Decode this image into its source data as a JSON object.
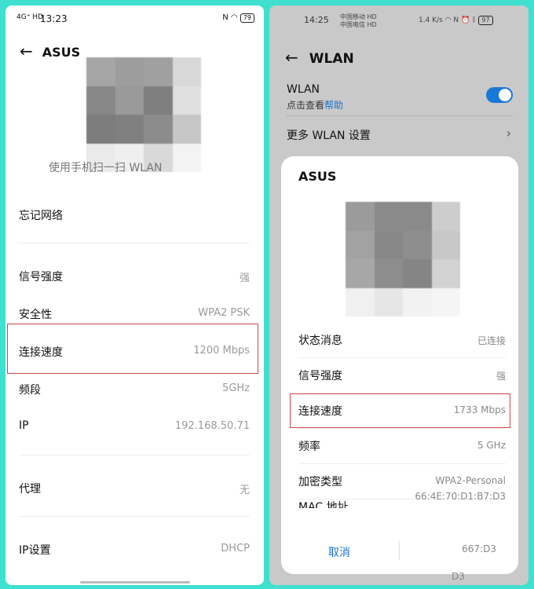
{
  "left": {
    "status": {
      "time": "13:23",
      "left_icons": "4G⁺ HD",
      "battery": "79"
    },
    "header": {
      "title": "ASUS"
    },
    "scan_text": "使用手机扫一扫  WLAN",
    "rows": [
      {
        "label": "忘记网络",
        "value": ""
      },
      {
        "label": "信号强度",
        "value": "强"
      },
      {
        "label": "安全性",
        "value": "WPA2 PSK"
      },
      {
        "label": "连接速度",
        "value": "1200 Mbps"
      },
      {
        "label": "频段",
        "value": "5GHz"
      },
      {
        "label": "IP",
        "value": "192.168.50.71"
      },
      {
        "label": "代理",
        "value": "无"
      },
      {
        "label": "IP设置",
        "value": "DHCP"
      }
    ]
  },
  "right": {
    "status": {
      "time": "14:25",
      "carrier1": "中国移动 HD",
      "carrier2": "中国电信 HD",
      "net_speed": "1.4 K/s",
      "battery": "97"
    },
    "header": {
      "title": "WLAN"
    },
    "wlan": {
      "label": "WLAN",
      "hint": "点击查看",
      "help": "帮助",
      "enabled": true
    },
    "more_settings": "更多 WLAN 设置",
    "dialog": {
      "title": "ASUS",
      "rows": [
        {
          "label": "状态消息",
          "value": "已连接"
        },
        {
          "label": "信号强度",
          "value": "强"
        },
        {
          "label": "连接速度",
          "value": "1733 Mbps"
        },
        {
          "label": "频率",
          "value": "5 GHz"
        },
        {
          "label": "加密类型",
          "value": "WPA2-Personal"
        },
        {
          "label": "MAC 地址",
          "value": "66:4E:70:D1:B7:D3"
        }
      ],
      "cancel": "取消",
      "behind_value": "667:D3",
      "behind_value2": "D3"
    }
  },
  "colors": {
    "background": "#3fe0d0",
    "highlight": "#d04646",
    "accent": "#1a73c9"
  },
  "icons": [
    "back-arrow-icon",
    "chevron-right-icon",
    "wifi-icon",
    "bluetooth-icon",
    "alarm-icon",
    "nfc-icon",
    "battery-icon",
    "signal-icon"
  ]
}
